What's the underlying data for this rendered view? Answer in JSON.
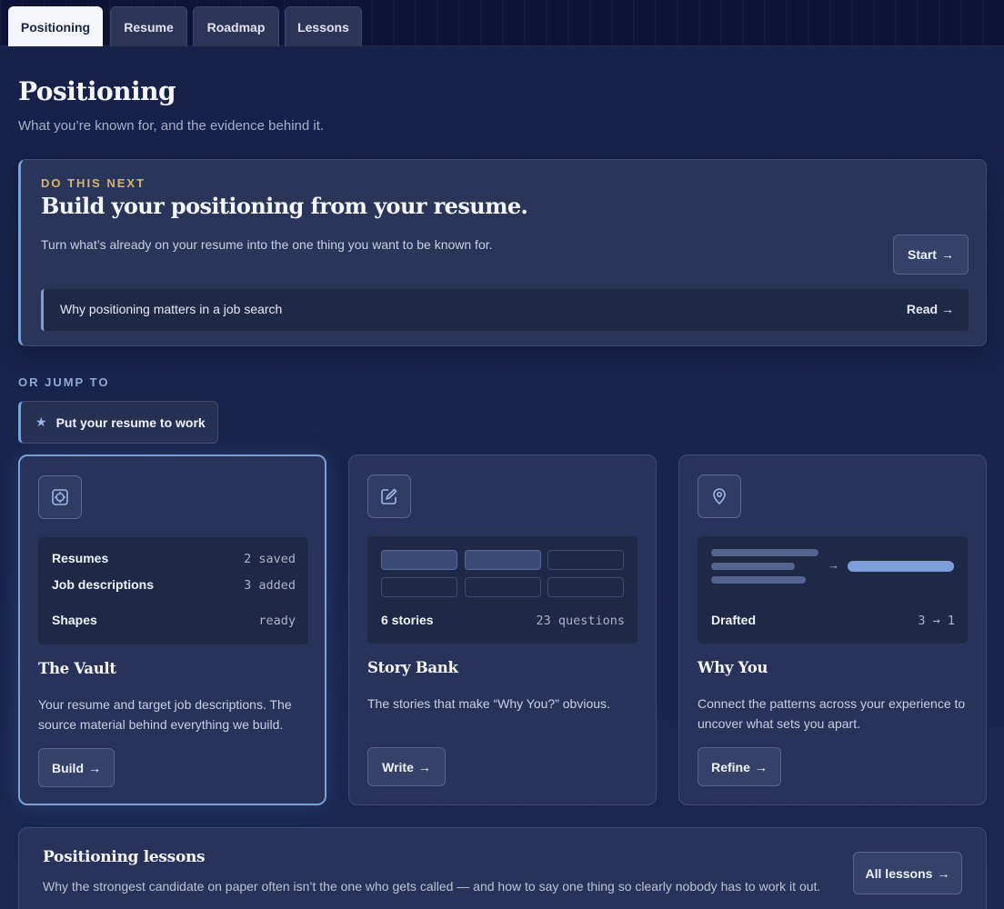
{
  "tabs": [
    {
      "label": "Positioning",
      "active": true
    },
    {
      "label": "Resume",
      "active": false
    },
    {
      "label": "Roadmap",
      "active": false
    },
    {
      "label": "Lessons",
      "active": false
    }
  ],
  "page": {
    "title": "Positioning",
    "subtitle": "What you’re known for, and the evidence behind it."
  },
  "next": {
    "eyebrow": "DO THIS NEXT",
    "title": "Build your positioning from your resume.",
    "description": "Turn what’s already on your resume into the one thing you want to be known for.",
    "start_label": "Start",
    "read": {
      "label": "Why positioning matters in a job search",
      "link": "Read"
    }
  },
  "jump": {
    "eyebrow": "OR JUMP TO",
    "chip_label": "Put your resume to work",
    "chip_icon": "star-icon"
  },
  "cards": [
    {
      "icon": "target-icon",
      "title": "The Vault",
      "description": "Your resume and target job descriptions. The source material behind everything we build.",
      "button": "Build",
      "rows": [
        {
          "label": "Resumes",
          "value": "2 saved"
        },
        {
          "label": "Job descriptions",
          "value": "3 added"
        },
        {
          "label": "Shapes",
          "value": "ready"
        }
      ]
    },
    {
      "icon": "edit-icon",
      "title": "Story Bank",
      "description": "The stories that make “Why You?” obvious.",
      "button": "Write",
      "stat_label": "6 stories",
      "stat_value": "23 questions"
    },
    {
      "icon": "location-pin-icon",
      "title": "Why You",
      "description": "Connect the patterns across your experience to uncover what sets you apart.",
      "button": "Refine",
      "stat_label": "Drafted",
      "stat_value": "3 → 1"
    }
  ],
  "lessons": {
    "title": "Positioning lessons",
    "description": "Why the strongest candidate on paper often isn’t the one who gets called — and how to say one thing so clearly nobody has to work it out.",
    "button": "All lessons"
  },
  "colors": {
    "accent": "#7c9fd6",
    "gold": "#d9b46a",
    "background": "#17244d",
    "card": "#27335a"
  }
}
